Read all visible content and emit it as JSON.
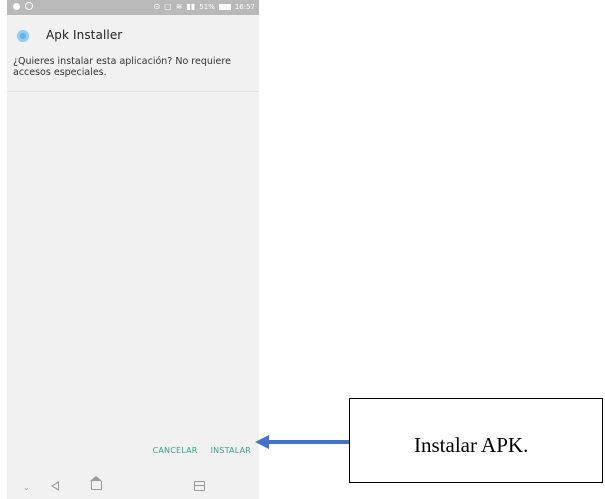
{
  "status_bar": {
    "signal_text": "51%",
    "time": "16:57",
    "icons": [
      "notification-icon",
      "sync-icon",
      "cast-icon",
      "screenshot-icon",
      "wifi-icon",
      "signal-icon",
      "battery-icon"
    ]
  },
  "app": {
    "title": "Apk Installer",
    "prompt": "¿Quieres instalar esta aplicación? No requiere accesos especiales."
  },
  "actions": {
    "cancel_label": "CANCELAR",
    "install_label": "INSTALAR",
    "accent_color": "#3e9b8f"
  },
  "nav_bar": {
    "icons": [
      "chevron-down-icon",
      "back-icon",
      "home-icon",
      "recent-apps-icon"
    ]
  },
  "annotation": {
    "label": "Instalar APK.",
    "arrow_color": "#4472c4"
  }
}
